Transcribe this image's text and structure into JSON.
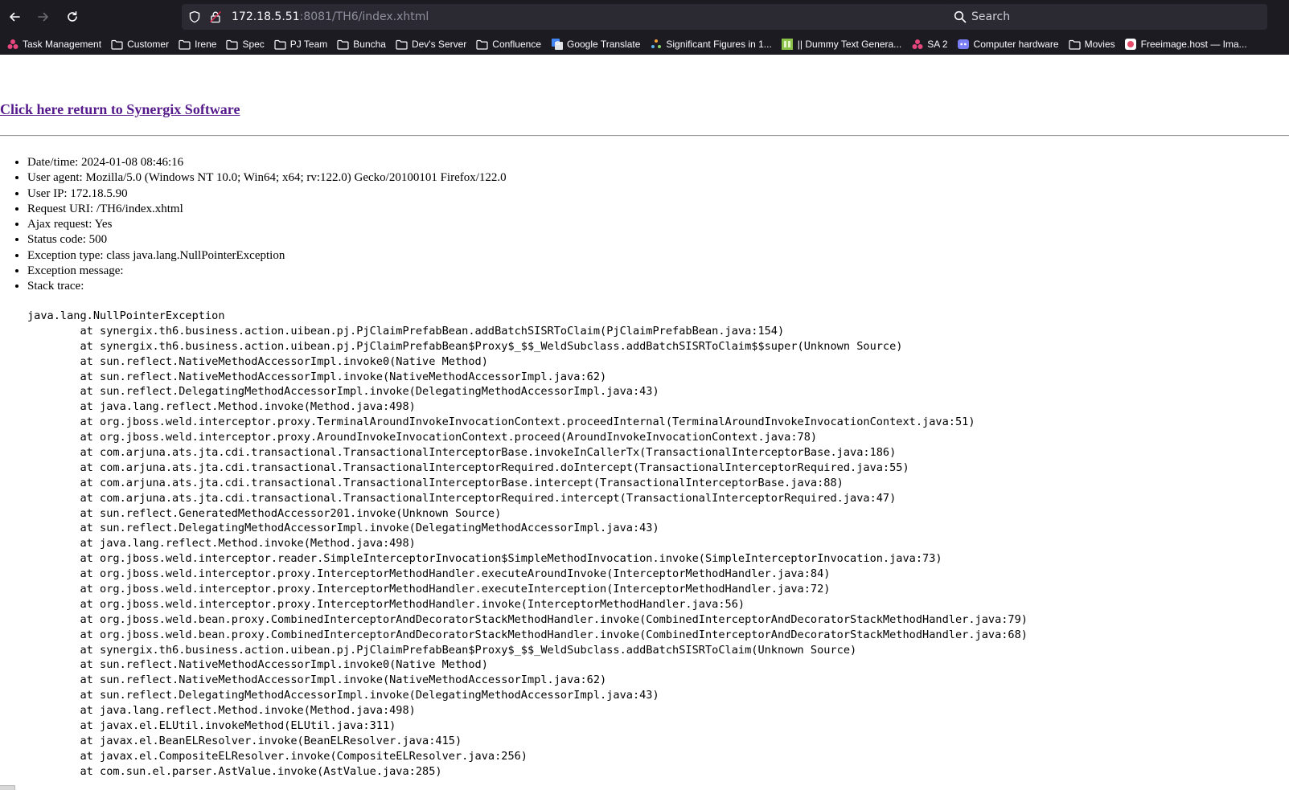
{
  "browser": {
    "url_host": "172.18.5.51",
    "url_rest": ":8081/TH6/index.xhtml",
    "search_placeholder": "Search",
    "bookmarks": [
      {
        "label": "Task Management",
        "icon": "dots-favicon",
        "color": "#e5477d"
      },
      {
        "label": "Customer",
        "icon": "folder-icon"
      },
      {
        "label": "Irene",
        "icon": "folder-icon"
      },
      {
        "label": "Spec",
        "icon": "folder-icon"
      },
      {
        "label": "PJ Team",
        "icon": "folder-icon"
      },
      {
        "label": "Buncha",
        "icon": "folder-icon"
      },
      {
        "label": "Dev's Server",
        "icon": "folder-icon"
      },
      {
        "label": "Confluence",
        "icon": "folder-icon"
      },
      {
        "label": "Google Translate",
        "icon": "translate-favicon",
        "color": "#4285f4"
      },
      {
        "label": "Significant Figures in 1...",
        "icon": "sparkle-favicon",
        "color": "#f2a33a"
      },
      {
        "label": "|| Dummy Text Genera...",
        "icon": "green-square-favicon",
        "color": "#8bc34a"
      },
      {
        "label": "SA 2",
        "icon": "dots-favicon",
        "color": "#e5477d"
      },
      {
        "label": "Computer hardware",
        "icon": "discord-favicon",
        "color": "#7b7ff6"
      },
      {
        "label": "Movies",
        "icon": "folder-icon"
      },
      {
        "label": "Freeimage.host — Ima...",
        "icon": "image-favicon",
        "color": "#e84c6b"
      }
    ]
  },
  "page": {
    "return_link": "Click here return to Synergix Software",
    "info": [
      "Date/time: 2024-01-08 08:46:16",
      "User agent: Mozilla/5.0 (Windows NT 10.0; Win64; x64; rv:122.0) Gecko/20100101 Firefox/122.0",
      "User IP: 172.18.5.90",
      "Request URI: /TH6/index.xhtml",
      "Ajax request: Yes",
      "Status code: 500",
      "Exception type: class java.lang.NullPointerException",
      "Exception message:",
      "Stack trace:"
    ],
    "stack_trace": [
      "java.lang.NullPointerException",
      "\tat synergix.th6.business.action.uibean.pj.PjClaimPrefabBean.addBatchSISRToClaim(PjClaimPrefabBean.java:154)",
      "\tat synergix.th6.business.action.uibean.pj.PjClaimPrefabBean$Proxy$_$$_WeldSubclass.addBatchSISRToClaim$$super(Unknown Source)",
      "\tat sun.reflect.NativeMethodAccessorImpl.invoke0(Native Method)",
      "\tat sun.reflect.NativeMethodAccessorImpl.invoke(NativeMethodAccessorImpl.java:62)",
      "\tat sun.reflect.DelegatingMethodAccessorImpl.invoke(DelegatingMethodAccessorImpl.java:43)",
      "\tat java.lang.reflect.Method.invoke(Method.java:498)",
      "\tat org.jboss.weld.interceptor.proxy.TerminalAroundInvokeInvocationContext.proceedInternal(TerminalAroundInvokeInvocationContext.java:51)",
      "\tat org.jboss.weld.interceptor.proxy.AroundInvokeInvocationContext.proceed(AroundInvokeInvocationContext.java:78)",
      "\tat com.arjuna.ats.jta.cdi.transactional.TransactionalInterceptorBase.invokeInCallerTx(TransactionalInterceptorBase.java:186)",
      "\tat com.arjuna.ats.jta.cdi.transactional.TransactionalInterceptorRequired.doIntercept(TransactionalInterceptorRequired.java:55)",
      "\tat com.arjuna.ats.jta.cdi.transactional.TransactionalInterceptorBase.intercept(TransactionalInterceptorBase.java:88)",
      "\tat com.arjuna.ats.jta.cdi.transactional.TransactionalInterceptorRequired.intercept(TransactionalInterceptorRequired.java:47)",
      "\tat sun.reflect.GeneratedMethodAccessor201.invoke(Unknown Source)",
      "\tat sun.reflect.DelegatingMethodAccessorImpl.invoke(DelegatingMethodAccessorImpl.java:43)",
      "\tat java.lang.reflect.Method.invoke(Method.java:498)",
      "\tat org.jboss.weld.interceptor.reader.SimpleInterceptorInvocation$SimpleMethodInvocation.invoke(SimpleInterceptorInvocation.java:73)",
      "\tat org.jboss.weld.interceptor.proxy.InterceptorMethodHandler.executeAroundInvoke(InterceptorMethodHandler.java:84)",
      "\tat org.jboss.weld.interceptor.proxy.InterceptorMethodHandler.executeInterception(InterceptorMethodHandler.java:72)",
      "\tat org.jboss.weld.interceptor.proxy.InterceptorMethodHandler.invoke(InterceptorMethodHandler.java:56)",
      "\tat org.jboss.weld.bean.proxy.CombinedInterceptorAndDecoratorStackMethodHandler.invoke(CombinedInterceptorAndDecoratorStackMethodHandler.java:79)",
      "\tat org.jboss.weld.bean.proxy.CombinedInterceptorAndDecoratorStackMethodHandler.invoke(CombinedInterceptorAndDecoratorStackMethodHandler.java:68)",
      "\tat synergix.th6.business.action.uibean.pj.PjClaimPrefabBean$Proxy$_$$_WeldSubclass.addBatchSISRToClaim(Unknown Source)",
      "\tat sun.reflect.NativeMethodAccessorImpl.invoke0(Native Method)",
      "\tat sun.reflect.NativeMethodAccessorImpl.invoke(NativeMethodAccessorImpl.java:62)",
      "\tat sun.reflect.DelegatingMethodAccessorImpl.invoke(DelegatingMethodAccessorImpl.java:43)",
      "\tat java.lang.reflect.Method.invoke(Method.java:498)",
      "\tat javax.el.ELUtil.invokeMethod(ELUtil.java:311)",
      "\tat javax.el.BeanELResolver.invoke(BeanELResolver.java:415)",
      "\tat javax.el.CompositeELResolver.invoke(CompositeELResolver.java:256)",
      "\tat com.sun.el.parser.AstValue.invoke(AstValue.java:285)"
    ]
  },
  "colors": {
    "chrome_bg": "#1c1b22",
    "field_bg": "#2b2a33",
    "link_visited": "#551a8b",
    "star_accent": "#0df"
  }
}
